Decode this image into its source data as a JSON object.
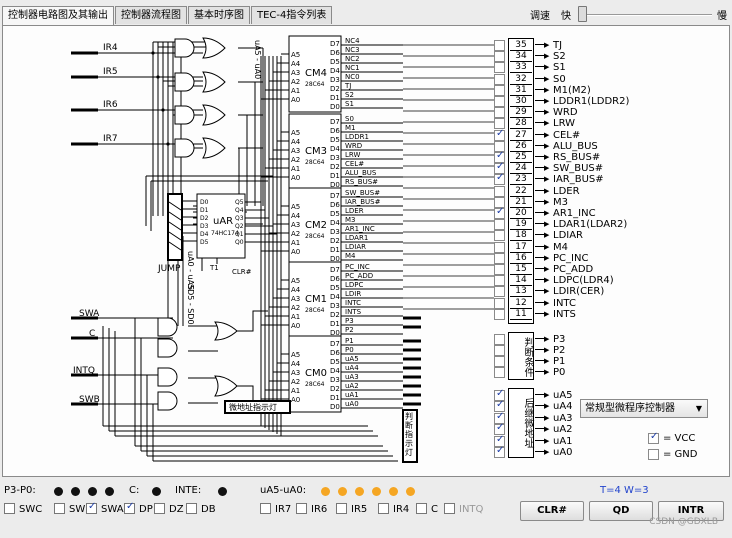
{
  "tabs": [
    {
      "label": "控制器电路图及其输出",
      "active": true
    },
    {
      "label": "控制器流程图",
      "active": false
    },
    {
      "label": "基本时序图",
      "active": false
    },
    {
      "label": "TEC-4指令列表",
      "active": false
    }
  ],
  "speed": {
    "label": "调速",
    "fast": "快",
    "slow": "慢",
    "level": 0.0
  },
  "inputs": {
    "ir": [
      "IR4",
      "IR5",
      "IR6",
      "IR7"
    ],
    "lower": [
      "SWA",
      "C",
      "INTQ",
      "SWB"
    ]
  },
  "chips": {
    "cm4": {
      "name": "CM4",
      "part": "28C64"
    },
    "cm3": {
      "name": "CM3",
      "part": "28C64"
    },
    "cm2": {
      "name": "CM2",
      "part": "28C64"
    },
    "cm1": {
      "name": "CM1",
      "part": "28C64"
    },
    "cm0": {
      "name": "CM0",
      "part": "28C64"
    },
    "uar": {
      "name": "uAR",
      "part": "74HC174"
    },
    "uar_pins_left": [
      "D0",
      "D1",
      "D2",
      "D3",
      "D4",
      "D5"
    ],
    "uar_pins_right": [
      "Q5",
      "Q4",
      "Q3",
      "Q2",
      "Q1",
      "Q0"
    ],
    "uar_t1": "T1",
    "uar_clr": "CLR#",
    "a_pins": [
      "A5",
      "A4",
      "A3",
      "A2",
      "A1",
      "A0"
    ],
    "d_pins": [
      "D7",
      "D6",
      "D5",
      "D4",
      "D3",
      "D2",
      "D1",
      "D0"
    ]
  },
  "labels": {
    "jump": "JUMP",
    "ua5_ua0_top": "uA5 - uA0",
    "ua0_ua5_mid": "uA0 - uA5",
    "sd5_sd0": "SD5 - SD0",
    "micro_addr_lamp": "微地址指示灯",
    "judge_lamp": "判断指示灯"
  },
  "signals": {
    "cm4": [
      "NC4",
      "NC3",
      "NC2",
      "NC1",
      "NC0",
      "TJ",
      "S2",
      "S1"
    ],
    "cm3": [
      "S0",
      "M1",
      "LDDR1",
      "WRD",
      "LRW",
      "CEL#",
      "ALU_BUS",
      "RS_BUS#"
    ],
    "cm2": [
      "SW_BUS#",
      "IAR_BUS#",
      "LDER",
      "M3",
      "AR1_INC",
      "LDAR1",
      "LDIAR",
      "M4"
    ],
    "cm1": [
      "PC_INC",
      "PC_ADD",
      "LDPC",
      "LDIR",
      "INTC",
      "INTS",
      "P3",
      "P2"
    ],
    "cm0": [
      "P1",
      "P0",
      "uA5",
      "uA4",
      "uA3",
      "uA2",
      "uA1",
      "uA0"
    ]
  },
  "outputs": [
    {
      "num": "35",
      "label": "TJ",
      "checked": false
    },
    {
      "num": "34",
      "label": "S2",
      "checked": false
    },
    {
      "num": "33",
      "label": "S1",
      "checked": false
    },
    {
      "num": "32",
      "label": "S0",
      "checked": false
    },
    {
      "num": "31",
      "label": "M1(M2)",
      "checked": false
    },
    {
      "num": "30",
      "label": "LDDR1(LDDR2)",
      "checked": false
    },
    {
      "num": "29",
      "label": "WRD",
      "checked": false
    },
    {
      "num": "28",
      "label": "LRW",
      "checked": false
    },
    {
      "num": "27",
      "label": "CEL#",
      "checked": true
    },
    {
      "num": "26",
      "label": "ALU_BUS",
      "checked": false
    },
    {
      "num": "25",
      "label": "RS_BUS#",
      "checked": true
    },
    {
      "num": "24",
      "label": "SW_BUS#",
      "checked": true
    },
    {
      "num": "23",
      "label": "IAR_BUS#",
      "checked": true
    },
    {
      "num": "22",
      "label": "LDER",
      "checked": false
    },
    {
      "num": "21",
      "label": "M3",
      "checked": false
    },
    {
      "num": "20",
      "label": "AR1_INC",
      "checked": true
    },
    {
      "num": "19",
      "label": "LDAR1(LDAR2)",
      "checked": false
    },
    {
      "num": "18",
      "label": "LDIAR",
      "checked": false
    },
    {
      "num": "17",
      "label": "M4",
      "checked": false
    },
    {
      "num": "16",
      "label": "PC_INC",
      "checked": false
    },
    {
      "num": "15",
      "label": "PC_ADD",
      "checked": false
    },
    {
      "num": "14",
      "label": "LDPC(LDR4)",
      "checked": false
    },
    {
      "num": "13",
      "label": "LDIR(CER)",
      "checked": false
    },
    {
      "num": "12",
      "label": "INTC",
      "checked": false
    },
    {
      "num": "11",
      "label": "INTS",
      "checked": false
    }
  ],
  "judge": {
    "title": "判断条件",
    "items": [
      {
        "label": "P3",
        "checked": false
      },
      {
        "label": "P2",
        "checked": false
      },
      {
        "label": "P1",
        "checked": false
      },
      {
        "label": "P0",
        "checked": false
      }
    ]
  },
  "next_addr": {
    "title": "后继微地址",
    "items": [
      {
        "label": "uA5",
        "checked": true
      },
      {
        "label": "uA4",
        "checked": true
      },
      {
        "label": "uA3",
        "checked": true
      },
      {
        "label": "uA2",
        "checked": true
      },
      {
        "label": "uA1",
        "checked": true
      },
      {
        "label": "uA0",
        "checked": true
      }
    ]
  },
  "controller_select": {
    "value": "常规型微程序控制器"
  },
  "power": [
    {
      "label": "= VCC",
      "checked": true
    },
    {
      "label": "= GND",
      "checked": false
    }
  ],
  "status": {
    "p_label": "P3-P0:",
    "c_label": "C:",
    "inte_label": "INTE:",
    "ua_label": "uA5-uA0:",
    "tw": "T=4 W=3",
    "p_leds": [
      "black",
      "black",
      "black",
      "black"
    ],
    "c_led": "black",
    "inte_led": "black",
    "ua_leds": [
      "orange",
      "orange",
      "orange",
      "orange",
      "orange",
      "orange"
    ]
  },
  "switches": [
    {
      "label": "SWC",
      "checked": false,
      "disabled": false
    },
    {
      "label": "SWB",
      "checked": false,
      "disabled": false
    },
    {
      "label": "SWA",
      "checked": true,
      "disabled": false
    },
    {
      "label": "DP",
      "checked": true,
      "disabled": false
    },
    {
      "label": "DZ",
      "checked": false,
      "disabled": false
    },
    {
      "label": "DB",
      "checked": false,
      "disabled": false
    },
    {
      "label": "IR7",
      "checked": false,
      "disabled": false
    },
    {
      "label": "IR6",
      "checked": false,
      "disabled": false
    },
    {
      "label": "IR5",
      "checked": false,
      "disabled": false
    },
    {
      "label": "IR4",
      "checked": false,
      "disabled": false
    },
    {
      "label": "C",
      "checked": false,
      "disabled": false
    },
    {
      "label": "INTQ",
      "checked": false,
      "disabled": true
    }
  ],
  "buttons": {
    "clr": "CLR#",
    "qd": "QD",
    "intr": "INTR"
  },
  "watermark": "CSDN @GDXLB"
}
